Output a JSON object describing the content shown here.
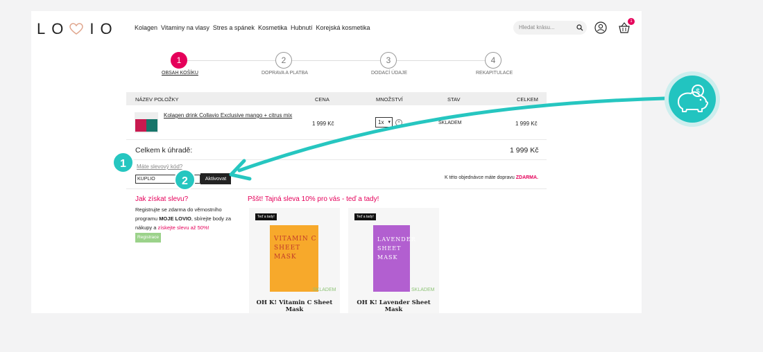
{
  "header": {
    "logo_text": "LOVIO",
    "nav": [
      "Kolagen",
      "Vitaminy na vlasy",
      "Stres a spánek",
      "Kosmetika",
      "Hubnutí",
      "Korejská kosmetika"
    ],
    "search_placeholder": "Hledat krásu...",
    "cart_count": "1"
  },
  "steps": [
    {
      "num": "1",
      "label": "OBSAH KOŠÍKU"
    },
    {
      "num": "2",
      "label": "DOPRAVA A PLATBA"
    },
    {
      "num": "3",
      "label": "DODACÍ ÚDAJE"
    },
    {
      "num": "4",
      "label": "REKAPITULACE"
    }
  ],
  "table": {
    "headers": {
      "name": "NÁZEV POLOŽKY",
      "price": "CENA",
      "qty": "MNOŽSTVÍ",
      "stav": "STAV",
      "total": "CELKEM"
    },
    "row": {
      "name": "Kolagen drink Collavio Exclusive mango + citrus mix",
      "price": "1 999 Kč",
      "qty": "1x",
      "stav": "SKLADEM",
      "total": "1 999 Kč"
    }
  },
  "summary": {
    "label": "Celkem k úhradě:",
    "value": "1 999 Kč"
  },
  "coupon": {
    "question": "Máte slevový kód?",
    "value": "KUPLIO",
    "button": "Aktivovat"
  },
  "shipping": {
    "text": "K této objednávce máte dopravu ",
    "free": "ZDARMA."
  },
  "how": {
    "title": "Jak získat slevu?",
    "text1": "Registrujte se zdarma do věrnostního programu ",
    "brand": "MOJE LOVIO",
    "text2": ", sbírejte body za nákupy a ",
    "highlight": "získejte slevu až 50%!",
    "button": "Registrace"
  },
  "promo": {
    "title": "Pššt! Tajná sleva 10% pro vás - teď a tady!",
    "cards": [
      {
        "tag": "Teď a tady!",
        "pack": "VITAMIN C SHEET MASK",
        "stock": "SKLADEM",
        "name": "OH K! Vitamin C Sheet Mask",
        "color": "#f7a92b"
      },
      {
        "tag": "Teď a tady!",
        "pack": "LAVENDER SHEET MASK",
        "stock": "SKLADEM",
        "name": "OH K! Lavender Sheet Mask",
        "color": "#b25fd0"
      }
    ]
  },
  "callouts": {
    "one": "1",
    "two": "2"
  },
  "colors": {
    "accent": "#e5005a",
    "teal": "#26c6c0",
    "green": "#9bd28a"
  }
}
